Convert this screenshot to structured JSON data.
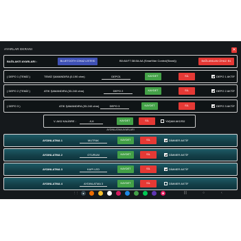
{
  "window": {
    "title": "AYARLAR EKRANI",
    "close_symbol": "✕"
  },
  "connection": {
    "label": "BAĞLANTI AYARLARI :",
    "bt_list_button": "BLUETOOTH CİHAZ LİSTESİ",
    "device_info": "B0:A6:F7:38:8A:AA (SmartVan Control(Stand))",
    "connected_button": "BAĞLANILAN CİHAZ: B1"
  },
  "tanks": [
    {
      "label": "( DEPO 1 (TEMİZ )",
      "sensor": "TEMİZ ŞAMANDIRA (0-190 ohm)",
      "name": "DEPO1",
      "save": "KAYDET",
      "delete": "SİL",
      "active_label": "DEPO 1 AKTİF",
      "active": true
    },
    {
      "label": "( DEPO 2 (TEMİZ )",
      "sensor": "ATIK ŞAMANDIRA (33-240 ohm)",
      "name": "DEPO 2",
      "save": "KAYDET",
      "delete": "SİL",
      "active_label": "DEPO 2 AKTİF",
      "active": true
    },
    {
      "label": "( DEPO 3 )",
      "sensor": "ATIK ŞAMANDIRA (33-240 ohm)",
      "name": "DEPO 3",
      "save": "KAYDET",
      "delete": "SİL",
      "active_label": "DEPO 3 AKTİF",
      "active": true
    }
  ],
  "battery": {
    "label": "V. AKÜ KALİBRE :",
    "value": "-0,6",
    "save": "KAYDET",
    "delete": "SİL",
    "alarm_label": "YAŞAM AKÜSÜ",
    "alarm_checked": false
  },
  "lighting_section": "AYDINLATMA AYARLARI",
  "lights": [
    {
      "label": "AYDINLATMA 1",
      "name": "MUTFAK",
      "save": "KAYDET",
      "delete": "SİL",
      "dimmer_label": "DİMMER AKTİF",
      "dimmer": true
    },
    {
      "label": "AYDINLATMA 2",
      "name": "OTURUM",
      "save": "KAYDET",
      "delete": "SİL",
      "dimmer_label": "DİMMER AKTİF",
      "dimmer": true
    },
    {
      "label": "AYDINLATMA 3",
      "name": "KAPI LED",
      "save": "KAYDET",
      "delete": "SİL",
      "dimmer_label": "DİMMER AKTİF",
      "dimmer": true
    },
    {
      "label": "AYDINLATMA 4",
      "name": "AYDINLATMA 3",
      "save": "KAYDET",
      "delete": "SİL",
      "dimmer_label": "DİMMER AKTİF",
      "dimmer": false
    }
  ],
  "colors": {
    "accent_green": "#43a047",
    "accent_red": "#e53935",
    "accent_blue": "#3f51b5",
    "panel_teal": "#1e5b66"
  },
  "navbar": {
    "apps": [
      "apps-grid-icon",
      "app-icon-1",
      "app-icon-2",
      "app-icon-3",
      "app-icon-4",
      "app-icon-5",
      "app-icon-6",
      "app-icon-7",
      "app-icon-8",
      "app-icon-9",
      "app-icon-10",
      "app-icon-11"
    ],
    "system": {
      "recents": "|||",
      "home": "○",
      "back": "‹"
    }
  }
}
